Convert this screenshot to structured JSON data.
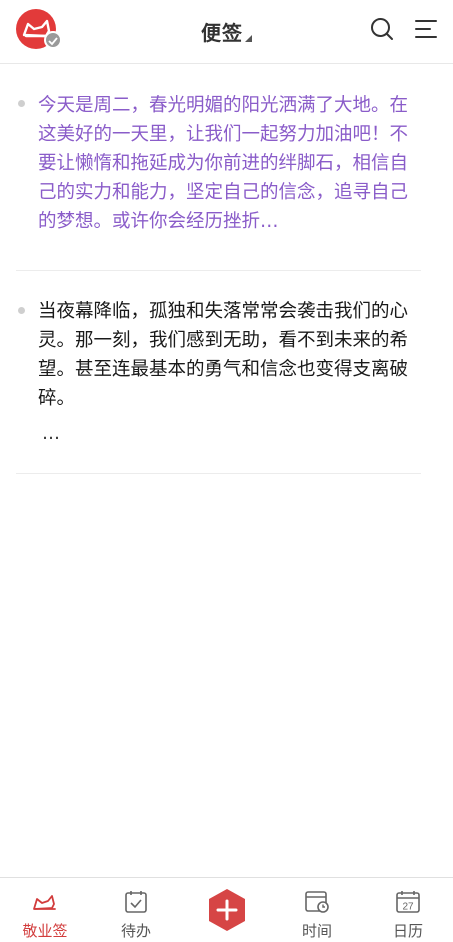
{
  "header": {
    "title": "便签",
    "avatar_icon": "dog-face-icon",
    "search_icon": "search-icon",
    "menu_icon": "menu-icon",
    "accent": "#e23a3a"
  },
  "notes": [
    {
      "text": "今天是周二，春光明媚的阳光洒满了大地。在这美好的一天里，让我们一起努力加油吧！不要让懒惰和拖延成为你前进的绊脚石，相信自己的实力和能力，坚定自己的信念，追寻自己的梦想。或许你会经历挫折…",
      "color": "#8a5cc9"
    },
    {
      "text": "当夜幕降临，孤独和失落常常会袭击我们的心灵。那一刻，我们感到无助，看不到未来的希望。甚至连最基本的勇气和信念也变得支离破碎。",
      "more": "…",
      "color": "#1a1a1a"
    }
  ],
  "tabbar": {
    "tabs": [
      {
        "label": "敬业签",
        "icon": "dog-icon",
        "active": true
      },
      {
        "label": "待办",
        "icon": "todo-calendar-icon",
        "active": false
      },
      {
        "label": "",
        "icon": "plus-icon",
        "active": false
      },
      {
        "label": "时间",
        "icon": "time-calendar-icon",
        "active": false
      },
      {
        "label": "日历",
        "icon": "calendar-icon",
        "date": "27",
        "active": false
      }
    ],
    "active_color": "#d23c3c"
  }
}
